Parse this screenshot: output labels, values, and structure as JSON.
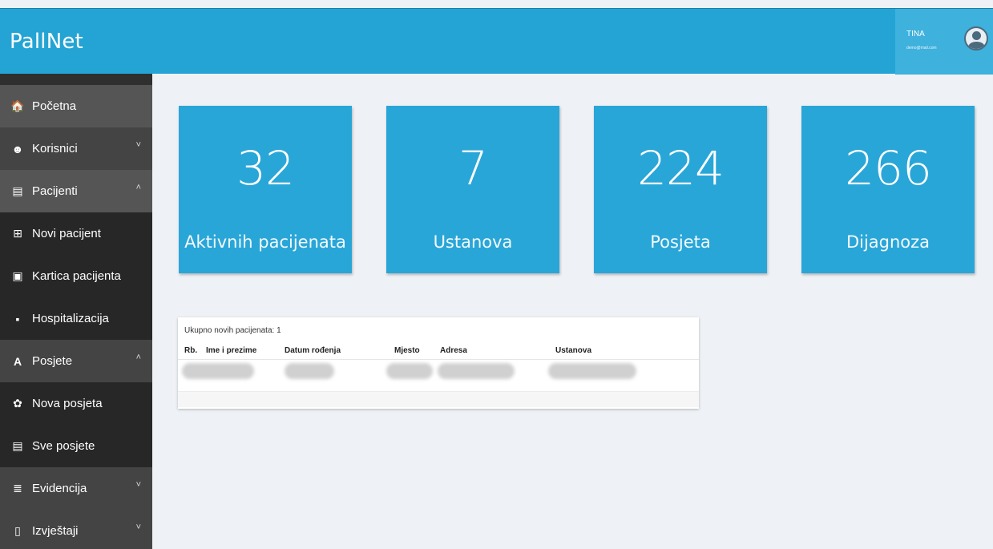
{
  "app": {
    "brand": "PallNet"
  },
  "user": {
    "name": "TINA",
    "email": "demo@mail.com"
  },
  "sidebar": {
    "items": [
      {
        "label": "Početna",
        "icon": "home-icon",
        "glyph": "🏠"
      },
      {
        "label": "Korisnici",
        "icon": "user-circle-icon",
        "glyph": "☻",
        "chevron": "˅"
      },
      {
        "label": "Pacijenti",
        "icon": "id-card-icon",
        "glyph": "▤",
        "chevron": "˄"
      },
      {
        "label": "Novi pacijent",
        "icon": "plus-square-icon",
        "glyph": "⊞"
      },
      {
        "label": "Kartica pacijenta",
        "icon": "card-icon",
        "glyph": "▣"
      },
      {
        "label": "Hospitalizacija",
        "icon": "hospital-icon",
        "glyph": "▪"
      },
      {
        "label": "Posjete",
        "icon": "letter-a-icon",
        "glyph": "A",
        "chevron": "˄"
      },
      {
        "label": "Nova posjeta",
        "icon": "handshake-icon",
        "glyph": "✿"
      },
      {
        "label": "Sve posjete",
        "icon": "list-icon",
        "glyph": "▤"
      },
      {
        "label": "Evidencija",
        "icon": "database-icon",
        "glyph": "≣",
        "chevron": "˅"
      },
      {
        "label": "Izvještaji",
        "icon": "document-icon",
        "glyph": "▯",
        "chevron": "˅"
      }
    ]
  },
  "stats": [
    {
      "value": "32",
      "label": "Aktivnih pacijenata"
    },
    {
      "value": "7",
      "label": "Ustanova"
    },
    {
      "value": "224",
      "label": "Posjeta"
    },
    {
      "value": "266",
      "label": "Dijagnoza"
    }
  ],
  "new_patients": {
    "title": "Ukupno novih pacijenata: 1",
    "columns": [
      "Rb.",
      "Ime i prezime",
      "Datum rođenja",
      "Mjesto",
      "Adresa",
      "Ustanova"
    ]
  },
  "colors": {
    "topbar": "#24a4d4",
    "card": "#29a6d8",
    "sidebar": "#2f2f2f"
  }
}
